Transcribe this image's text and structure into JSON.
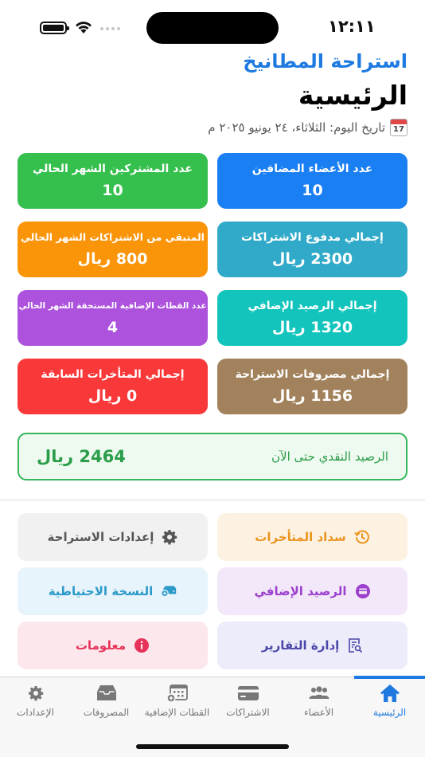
{
  "status_bar": {
    "time": "١٢:١١"
  },
  "header": {
    "app_name": "استراحة المطانيخ",
    "page_title": "الرئيسية",
    "date_text": "تاريخ اليوم: الثلاثاء، ٢٤ يونيو ٢٠٢٥ م",
    "calendar_day": "17"
  },
  "cards": [
    {
      "title": "عدد الأعضاء المضافين",
      "value": "10",
      "color": "#1a7ff2"
    },
    {
      "title": "عدد المشتركين الشهر الحالي",
      "value": "10",
      "color": "#35c04e"
    },
    {
      "title": "إجمالي مدفوع الاشتراكات",
      "value": "2300 ريال",
      "color": "#30aac8"
    },
    {
      "title": "المتبقي من الاشتراكات الشهر الحالي",
      "value": "800 ريال",
      "color": "#fa9408"
    },
    {
      "title": "إجمالي الرصيد الإضافي",
      "value": "1320 ريال",
      "color": "#12c4bc"
    },
    {
      "title": "عدد القطات الإضافية المستحقة الشهر الحالي",
      "value": "4",
      "color": "#ac52dc"
    },
    {
      "title": "إجمالي مصروفات الاستراحة",
      "value": "1156 ريال",
      "color": "#a2825c"
    },
    {
      "title": "إجمالي المتأخرات السابقة",
      "value": "0 ريال",
      "color": "#f9383a"
    }
  ],
  "cash_balance": {
    "label": "الرصيد النقدي حتى الآن",
    "value": "2464 ريال"
  },
  "actions": [
    {
      "label": "سداد المتأخرات",
      "icon": "clock-history-icon",
      "bg": "#fdf2e2",
      "color": "#ec9420"
    },
    {
      "label": "إعدادات الاستراحة",
      "icon": "gear-icon",
      "bg": "#f1f1f2",
      "color": "#555555"
    },
    {
      "label": "الرصيد الإضافي",
      "icon": "card-icon",
      "bg": "#f3e8f9",
      "color": "#9b3fcc"
    },
    {
      "label": "النسخة الاحتياطية",
      "icon": "external-drive-add-icon",
      "bg": "#e8f4fb",
      "color": "#2a9ac8"
    },
    {
      "label": "إدارة التقارير",
      "icon": "report-search-icon",
      "bg": "#ececfa",
      "color": "#4a47a8"
    },
    {
      "label": "معلومات",
      "icon": "info-icon",
      "bg": "#fce8ec",
      "color": "#e6335a"
    }
  ],
  "tabs": [
    {
      "label": "الرئيسية",
      "icon": "home-icon",
      "active": true
    },
    {
      "label": "الأعضاء",
      "icon": "people-icon",
      "active": false
    },
    {
      "label": "الاشتراكات",
      "icon": "credit-card-icon",
      "active": false
    },
    {
      "label": "القطات الإضافية",
      "icon": "calendar-add-icon",
      "active": false
    },
    {
      "label": "المصروفات",
      "icon": "tray-icon",
      "active": false
    },
    {
      "label": "الإعدادات",
      "icon": "gear-icon",
      "active": false
    }
  ],
  "colors": {
    "accent": "#1e7ae0",
    "cash_green": "#2a9d48",
    "tab_inactive": "#777777"
  }
}
